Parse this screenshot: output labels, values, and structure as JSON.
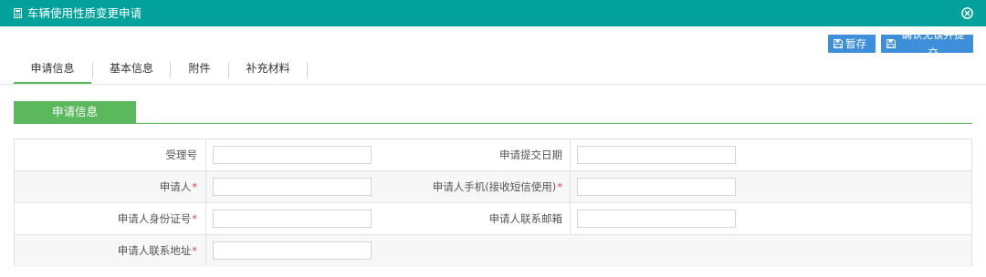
{
  "window": {
    "title": "车辆使用性质变更申请",
    "title_icon": "calculator-icon",
    "close_icon": "close-circle-icon"
  },
  "toolbar": {
    "save_label": "暂存",
    "submit_label": "确认无误并提交",
    "button_icon": "floppy-disk-icon",
    "accent": "#3d8fd9"
  },
  "tabs": [
    {
      "label": "申请信息",
      "active": true
    },
    {
      "label": "基本信息",
      "active": false
    },
    {
      "label": "附件",
      "active": false
    },
    {
      "label": "补充材料",
      "active": false
    }
  ],
  "section": {
    "title": "申请信息",
    "color": "#5cb85c"
  },
  "form": {
    "rows": [
      {
        "left_label": "受理号",
        "left_required": false,
        "left_value": "",
        "right_label": "申请提交日期",
        "right_required": false,
        "right_value": ""
      },
      {
        "left_label": "申请人",
        "left_required": true,
        "left_value": "",
        "right_label": "申请人手机(接收短信使用)",
        "right_required": true,
        "right_value": ""
      },
      {
        "left_label": "申请人身份证号",
        "left_required": true,
        "left_value": "",
        "right_label": "申请人联系邮箱",
        "right_required": false,
        "right_value": ""
      },
      {
        "left_label": "申请人联系地址",
        "left_required": true,
        "left_value": ""
      }
    ],
    "required_mark": "*"
  },
  "colors": {
    "titlebar": "#03a19b",
    "required": "#e0474c"
  }
}
